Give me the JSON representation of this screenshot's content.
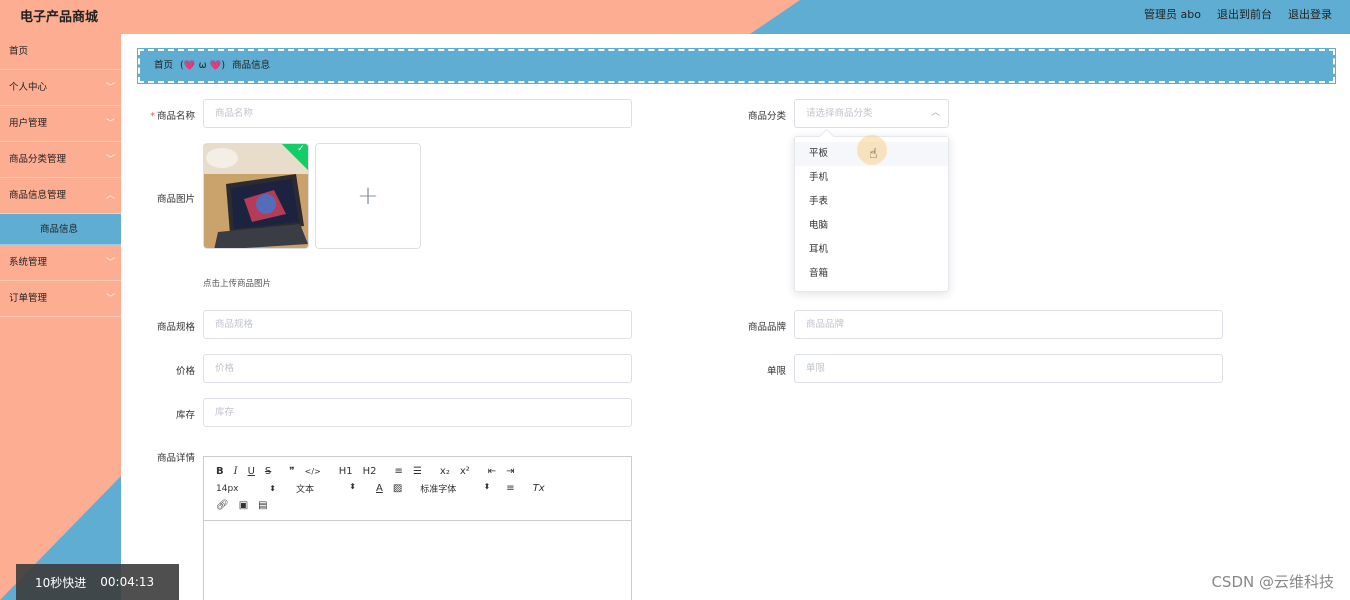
{
  "header": {
    "brand": "电子产品商城",
    "admin_label": "管理员 abo",
    "front_link": "退出到前台",
    "logout_link": "退出登录"
  },
  "sidebar": {
    "items": [
      {
        "label": "首页",
        "has_chevron": false
      },
      {
        "label": "个人中心",
        "has_chevron": true
      },
      {
        "label": "用户管理",
        "has_chevron": true
      },
      {
        "label": "商品分类管理",
        "has_chevron": true
      },
      {
        "label": "商品信息管理",
        "has_chevron": true
      },
      {
        "label": "商品信息",
        "sub": true,
        "active": true
      },
      {
        "label": "系统管理",
        "has_chevron": true
      },
      {
        "label": "订单管理",
        "has_chevron": true
      }
    ]
  },
  "breadcrumb": {
    "home": "首页",
    "separator": "(💗 ω 💗)",
    "current": "商品信息"
  },
  "form": {
    "name_label": "商品名称",
    "name_placeholder": "商品名称",
    "category_label": "商品分类",
    "category_placeholder": "请选择商品分类",
    "image_label": "商品图片",
    "upload_tip": "点击上传商品图片",
    "upload_add": "+",
    "spec_label": "商品规格",
    "spec_placeholder": "商品规格",
    "brand_label": "商品品牌",
    "brand_placeholder": "商品品牌",
    "price_label": "价格",
    "price_placeholder": "价格",
    "limit_label": "单限",
    "limit_placeholder": "单限",
    "stock_label": "库存",
    "stock_placeholder": "库存",
    "detail_label": "商品详情"
  },
  "category_dropdown": {
    "options": [
      "平板",
      "手机",
      "手表",
      "电脑",
      "耳机",
      "音箱"
    ],
    "hovered_index": 0
  },
  "editor_toolbar": {
    "row1": [
      "B",
      "I",
      "U",
      "S",
      "❞",
      "</>",
      "H1",
      "H2",
      "≡",
      "☰",
      "x₂",
      "x²",
      "⇤",
      "⇥"
    ],
    "font_size": "14px",
    "text_type": "文本",
    "font_color": "A",
    "font_family": "标准字体",
    "align": "≡",
    "clear": "Tx",
    "row3": [
      "link-icon",
      "image-icon",
      "video-icon"
    ]
  },
  "video_overlay": {
    "fast_forward": "10秒快进",
    "time": "00:04:13"
  },
  "watermark": "CSDN @云维科技",
  "colors": {
    "peach": "#fdad91",
    "blue": "#5fadd3",
    "success": "#13ce66",
    "required": "#e45656"
  }
}
